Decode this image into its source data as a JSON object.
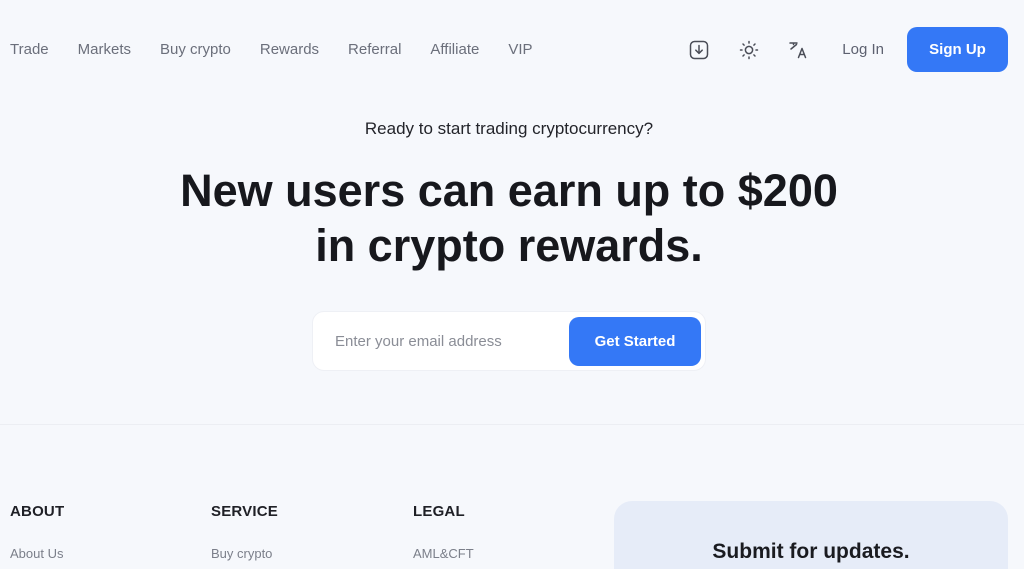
{
  "nav": {
    "links": [
      "Trade",
      "Markets",
      "Buy crypto",
      "Rewards",
      "Referral",
      "Affiliate",
      "VIP"
    ],
    "login_label": "Log In",
    "signup_label": "Sign Up",
    "icons": [
      "download-icon",
      "sun-icon",
      "translate-icon"
    ]
  },
  "hero": {
    "kicker": "Ready to start trading cryptocurrency?",
    "title_line1": "New users can earn up to $200",
    "title_line2": "in crypto rewards.",
    "email_placeholder": "Enter your email address",
    "cta_label": "Get Started"
  },
  "footer": {
    "about": {
      "heading": "ABOUT",
      "links": [
        "About Us"
      ]
    },
    "service": {
      "heading": "SERVICE",
      "links": [
        "Buy crypto"
      ]
    },
    "legal": {
      "heading": "LEGAL",
      "links": [
        "AML&CFT"
      ]
    },
    "updates_title": "Submit for updates."
  },
  "colors": {
    "accent": "#3478f6",
    "background": "#f6f8fc",
    "card": "#e6ecf8"
  }
}
